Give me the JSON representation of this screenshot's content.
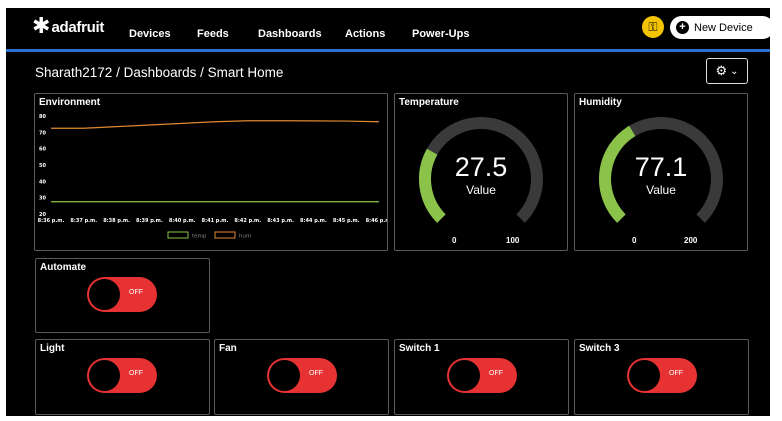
{
  "nav": {
    "logo_text": "adafruit",
    "items": [
      "Devices",
      "Feeds",
      "Dashboards",
      "Actions",
      "Power-Ups"
    ],
    "new_device_label": "New Device"
  },
  "breadcrumb": "Sharath2172 / Dashboards / Smart Home",
  "environment": {
    "title": "Environment",
    "chart_data": {
      "type": "line",
      "title": "Environment",
      "x": [
        "8:36 p.m.",
        "8:37 p.m.",
        "8:38 p.m.",
        "8:39 p.m.",
        "8:40 p.m.",
        "8:41 p.m.",
        "8:42 p.m.",
        "8:43 p.m.",
        "8:44 p.m.",
        "8:45 p.m.",
        "8:46 p.m."
      ],
      "ylim": [
        20,
        80
      ],
      "yticks": [
        20,
        30,
        40,
        50,
        60,
        70,
        80
      ],
      "series": [
        {
          "name": "temp",
          "color": "#8bc34a",
          "values": [
            27.5,
            27.5,
            27.5,
            27.5,
            27.5,
            27.5,
            27.5,
            27.5,
            27.5,
            27.5,
            27.5
          ]
        },
        {
          "name": "hum",
          "color": "#e0892f",
          "values": [
            72.5,
            72.5,
            73.5,
            74.5,
            75.5,
            76.5,
            77.1,
            77.1,
            77.0,
            76.9,
            76.5
          ]
        }
      ],
      "grid": false,
      "legend": "bottom-center"
    }
  },
  "temperature": {
    "title": "Temperature",
    "value": "27.5",
    "label": "Value",
    "min": "0",
    "max": "100",
    "fraction": 0.275,
    "color": "#8bc34a"
  },
  "humidity": {
    "title": "Humidity",
    "value": "77.1",
    "label": "Value",
    "min": "0",
    "max": "200",
    "fraction": 0.3855,
    "color": "#8bc34a"
  },
  "toggles": {
    "automate": {
      "title": "Automate",
      "state": "OFF"
    },
    "light": {
      "title": "Light",
      "state": "OFF"
    },
    "fan": {
      "title": "Fan",
      "state": "OFF"
    },
    "switch1": {
      "title": "Switch 1",
      "state": "OFF"
    },
    "switch3": {
      "title": "Switch 3",
      "state": "OFF"
    }
  },
  "colors": {
    "accent_blue": "#2f6fd6",
    "toggle_off": "#e63232",
    "key_yellow": "#f5c400",
    "gauge_track": "#3a3a3a"
  }
}
